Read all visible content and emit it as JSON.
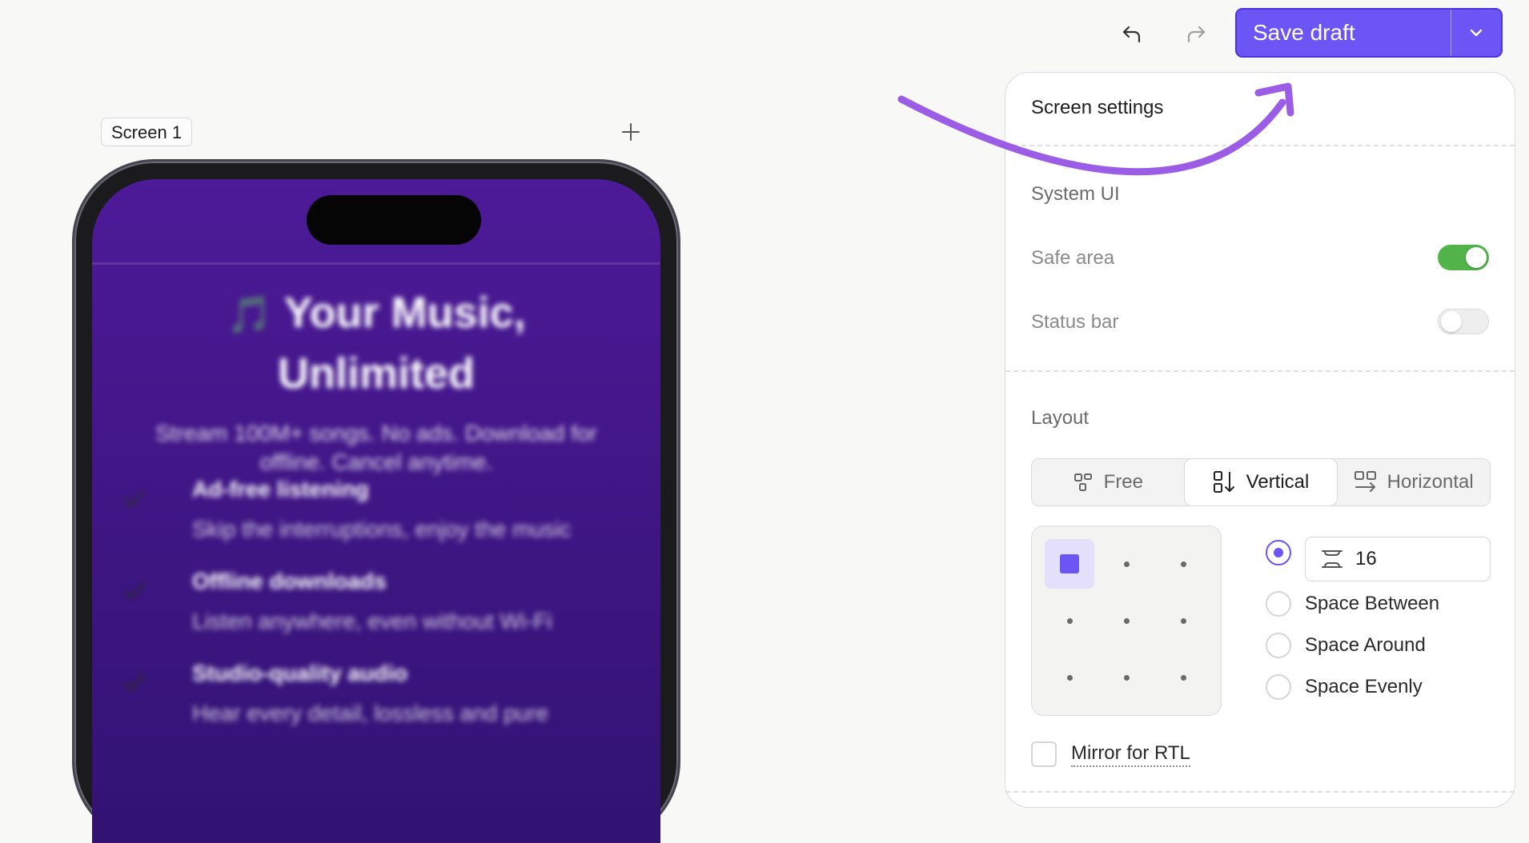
{
  "toolbar": {
    "undo_icon": "undo-icon",
    "redo_icon": "redo-icon",
    "save_label": "Save draft",
    "save_caret_icon": "chevron-down-icon",
    "accent": "#6b55f5"
  },
  "canvas": {
    "screen_label": "Screen 1",
    "add_icon": "plus-icon"
  },
  "preview": {
    "title_emoji": "🎵",
    "title_line1": "Your Music,",
    "title_line2": "Unlimited",
    "subtitle_line1": "Stream 100M+ songs. No ads. Download for",
    "subtitle_line2": "offline. Cancel anytime.",
    "features": [
      {
        "title": "Ad-free listening",
        "desc": "Skip the interruptions, enjoy the music"
      },
      {
        "title": "Offline downloads",
        "desc": "Listen anywhere, even without Wi-Fi"
      },
      {
        "title": "Studio-quality audio",
        "desc": "Hear every detail, lossless and pure"
      }
    ]
  },
  "panel": {
    "title": "Screen settings",
    "system_ui": {
      "label": "System UI",
      "safe_area": {
        "label": "Safe area",
        "on": true
      },
      "status_bar": {
        "label": "Status bar",
        "on": false
      }
    },
    "layout": {
      "label": "Layout",
      "modes": [
        {
          "label": "Free",
          "icon": "free-layout-icon",
          "active": false
        },
        {
          "label": "Vertical",
          "icon": "vertical-layout-icon",
          "active": true
        },
        {
          "label": "Horizontal",
          "icon": "horizontal-layout-icon",
          "active": false
        }
      ],
      "gap_value": "16",
      "distribution": [
        "Space Between",
        "Space Around",
        "Space Evenly"
      ],
      "mirror_label": "Mirror for RTL"
    }
  }
}
